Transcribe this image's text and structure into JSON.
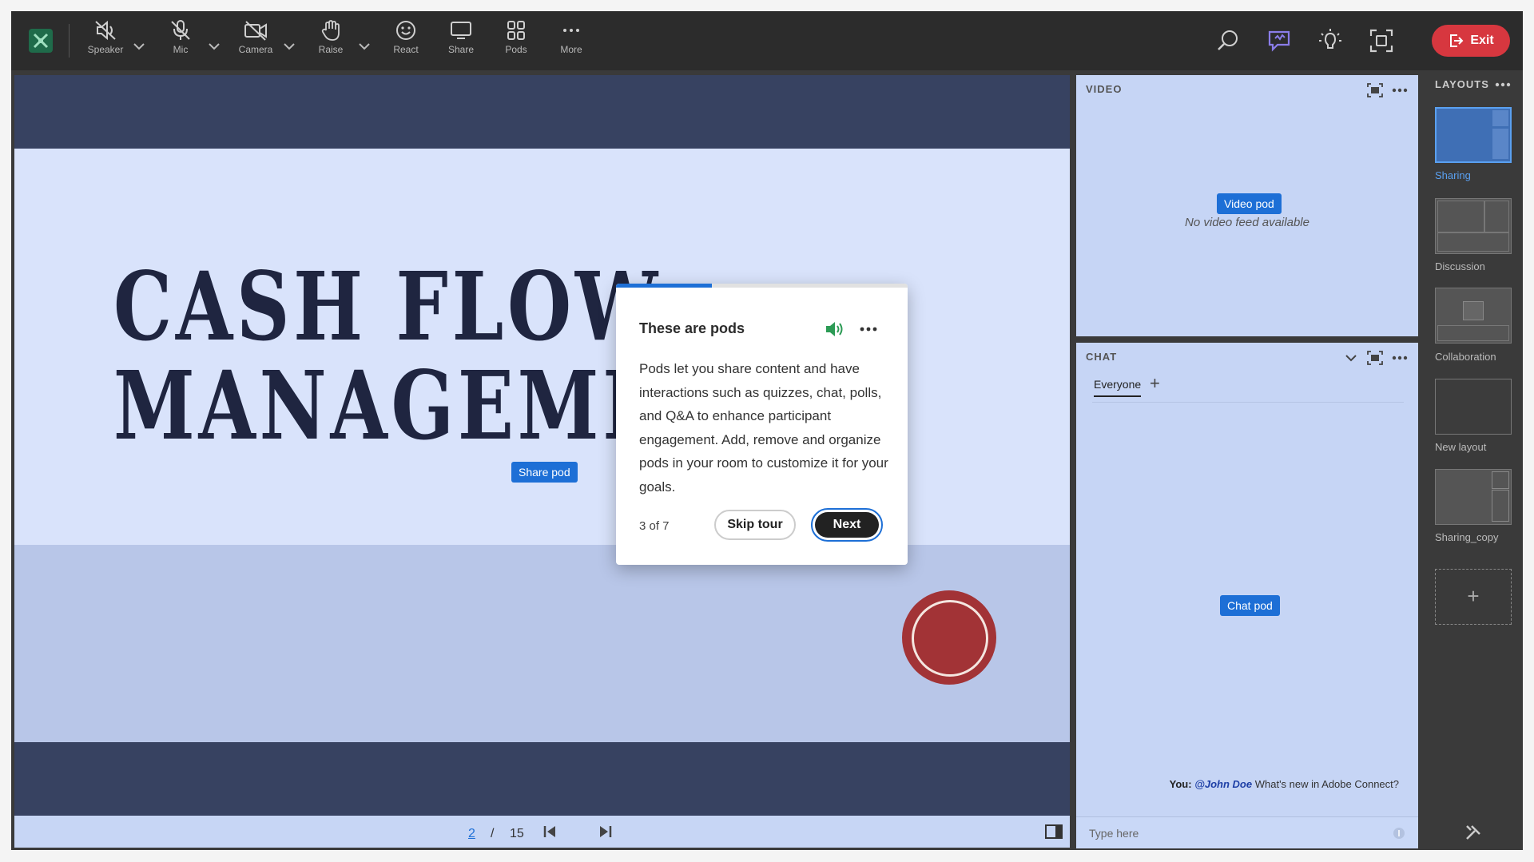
{
  "toolbar": {
    "buttons": [
      {
        "label": "Speaker",
        "icon": "speaker-muted-icon"
      },
      {
        "label": "Mic",
        "icon": "mic-muted-icon"
      },
      {
        "label": "Camera",
        "icon": "camera-off-icon"
      },
      {
        "label": "Raise",
        "icon": "hand-icon"
      },
      {
        "label": "React",
        "icon": "smiley-icon"
      },
      {
        "label": "Share",
        "icon": "monitor-icon"
      },
      {
        "label": "Pods",
        "icon": "grid-icon"
      },
      {
        "label": "More",
        "icon": "ellipsis-icon"
      }
    ],
    "exit_label": "Exit"
  },
  "colors": {
    "accent": "#1d6fd6",
    "exit": "#d7373f",
    "toolbar_bg": "#2c2c2c"
  },
  "slide": {
    "title": "CASH FLOW\nMANAGEME",
    "share_pod_tag": "Share pod",
    "page_current": "2",
    "page_separator": "/",
    "page_total": "15"
  },
  "video_pod": {
    "header": "VIDEO",
    "tag": "Video pod",
    "empty_text": "No video feed available"
  },
  "chat_pod": {
    "header": "CHAT",
    "tab": "Everyone",
    "tag": "Chat pod",
    "message": {
      "sender": "You:",
      "mention": "@John Doe",
      "text": "What's new in Adobe Connect?"
    },
    "input_placeholder": "Type here"
  },
  "layouts": {
    "header": "LAYOUTS",
    "items": [
      {
        "label": "Sharing",
        "active": true
      },
      {
        "label": "Discussion",
        "active": false
      },
      {
        "label": "Collaboration",
        "active": false
      },
      {
        "label": "New layout",
        "active": false
      },
      {
        "label": "Sharing_copy",
        "active": false
      }
    ]
  },
  "tour": {
    "title": "These are pods",
    "body": "Pods let you share content and have interactions such as quizzes, chat, polls, and Q&A to enhance participant engagement. Add, remove and organize pods in your room to customize it for your goals.",
    "step": "3 of 7",
    "progress": 0.33,
    "skip_label": "Skip tour",
    "next_label": "Next"
  }
}
